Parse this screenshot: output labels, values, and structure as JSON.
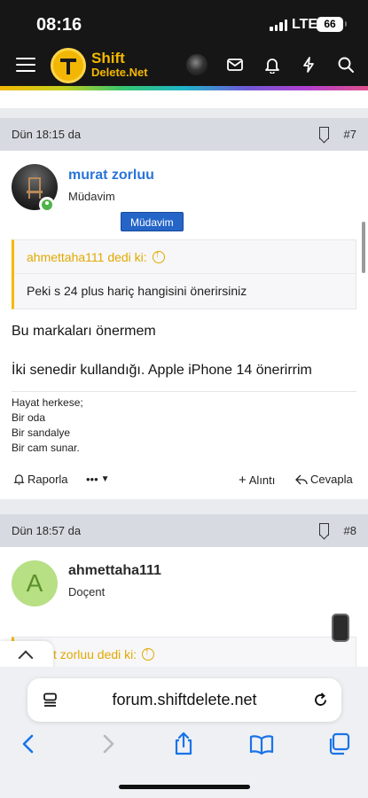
{
  "status_bar": {
    "time": "08:16",
    "network": "LTE",
    "battery": "66"
  },
  "header": {
    "logo_line1": "Shift",
    "logo_line2": "Delete.Net",
    "icons": [
      "menu-icon",
      "user-avatar",
      "mail-icon",
      "bell-icon",
      "bolt-icon",
      "search-icon"
    ]
  },
  "posts": [
    {
      "date": "Dün 18:15 da",
      "number": "#7",
      "author": "murat zorluu",
      "user_title": "Müdavim",
      "badge": "Müdavim",
      "quote_author": "ahmettaha111 dedi ki:",
      "quote_text": "Peki s 24 plus hariç hangisini önerirsiniz",
      "message_line1": "Bu markaları önermem",
      "message_line2": "İki senedir kullandığı. Apple iPhone 14 önerirrim",
      "signature": [
        "Hayat herkese;",
        "Bir oda",
        "Bir sandalye",
        "Bir cam sunar."
      ],
      "actions": {
        "report": "Raporla",
        "more": "•••",
        "quote": "Alıntı",
        "reply": "Cevapla"
      }
    },
    {
      "date": "Dün 18:57 da",
      "number": "#8",
      "avatar_letter": "A",
      "author": "ahmettaha111",
      "user_title": "Doçent",
      "quote_author_partial": "t zorluu dedi ki:"
    }
  ],
  "browser": {
    "url": "forum.shiftdelete.net"
  },
  "colors": {
    "accent_yellow": "#f5b800",
    "link_blue": "#2a74d9",
    "badge_blue": "#2565c8",
    "online_green": "#52b34a"
  }
}
